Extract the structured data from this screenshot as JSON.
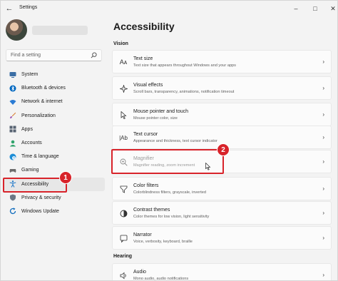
{
  "window": {
    "title": "Settings"
  },
  "search": {
    "placeholder": "Find a setting"
  },
  "sidebar": {
    "items": [
      {
        "label": "System",
        "icon": "monitor-icon",
        "color": "#3b6ea5"
      },
      {
        "label": "Bluetooth & devices",
        "icon": "bluetooth-icon",
        "color": "#0067c0"
      },
      {
        "label": "Network & internet",
        "icon": "wifi-icon",
        "color": "#2b7bd4"
      },
      {
        "label": "Personalization",
        "icon": "brush-icon",
        "color": "#d97a2b"
      },
      {
        "label": "Apps",
        "icon": "apps-icon",
        "color": "#566271"
      },
      {
        "label": "Accounts",
        "icon": "person-icon",
        "color": "#2fa36b"
      },
      {
        "label": "Time & language",
        "icon": "globe-clock-icon",
        "color": "#1c8dd6"
      },
      {
        "label": "Gaming",
        "icon": "gamepad-icon",
        "color": "#6b6b6b"
      },
      {
        "label": "Accessibility",
        "icon": "accessibility-icon",
        "color": "#1a76c9",
        "active": true
      },
      {
        "label": "Privacy & security",
        "icon": "shield-icon",
        "color": "#6b7785"
      },
      {
        "label": "Windows Update",
        "icon": "update-icon",
        "color": "#0f6cbd"
      }
    ]
  },
  "main": {
    "title": "Accessibility",
    "sections": {
      "vision": "Vision",
      "hearing": "Hearing"
    },
    "cards": [
      {
        "title": "Text size",
        "desc": "Text size that appears throughout Windows and your apps",
        "icon": "text-size-icon"
      },
      {
        "title": "Visual effects",
        "desc": "Scroll bars, transparency, animations, notification timeout",
        "icon": "visual-effects-icon"
      },
      {
        "title": "Mouse pointer and touch",
        "desc": "Mouse pointer color, size",
        "icon": "mouse-pointer-icon"
      },
      {
        "title": "Text cursor",
        "desc": "Appearance and thickness, text cursor indicator",
        "icon": "text-cursor-icon"
      },
      {
        "title": "Magnifier",
        "desc": "Magnifier reading, zoom increment",
        "icon": "magnifier-icon"
      },
      {
        "title": "Color filters",
        "desc": "Colorblindness filters, grayscale, inverted",
        "icon": "color-filters-icon"
      },
      {
        "title": "Contrast themes",
        "desc": "Color themes for low vision, light sensitivity",
        "icon": "contrast-icon"
      },
      {
        "title": "Narrator",
        "desc": "Voice, verbosity, keyboard, braille",
        "icon": "narrator-icon"
      },
      {
        "title": "Audio",
        "desc": "Mono audio, audio notifications",
        "icon": "audio-icon"
      }
    ]
  },
  "annotations": [
    {
      "label": "1",
      "target": "Accessibility"
    },
    {
      "label": "2",
      "target": "Magnifier"
    }
  ],
  "colors": {
    "accent": "#005fb8",
    "annotation": "#d8232a"
  }
}
